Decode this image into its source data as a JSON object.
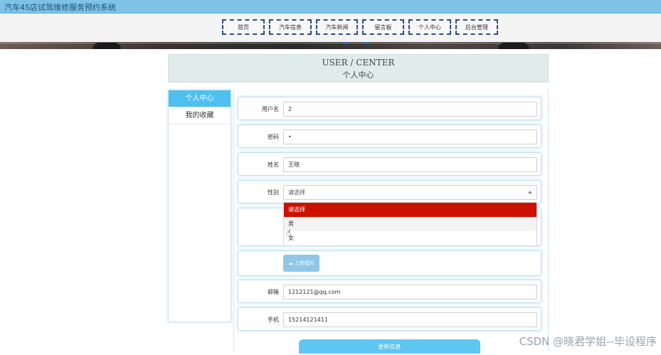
{
  "app": {
    "title": "汽车4S店试驾维修服务预约系统"
  },
  "nav": {
    "items": [
      "首页",
      "汽车信息",
      "汽车新闻",
      "留言板",
      "个人中心",
      "后台管理"
    ]
  },
  "heading": {
    "en": "USER / CENTER",
    "cn": "个人中心"
  },
  "sidebar": {
    "items": [
      {
        "label": "个人中心",
        "active": true
      },
      {
        "label": "我的收藏",
        "active": false
      }
    ]
  },
  "form": {
    "username_label": "用户名",
    "username_value": "2",
    "password_label": "密码",
    "password_value": "•",
    "name_label": "姓名",
    "name_value": "王晓",
    "gender_label": "性别",
    "gender_value": "请选择",
    "gender_options": [
      "请选择",
      "男",
      "女"
    ],
    "upload_label": "上传图片",
    "email_label": "邮箱",
    "email_value": "1212121@qq.com",
    "phone_label": "手机",
    "phone_value": "15214121411",
    "submit_label": "更新信息"
  },
  "watermark": "CSDN @晓君学姐--毕设程序"
}
